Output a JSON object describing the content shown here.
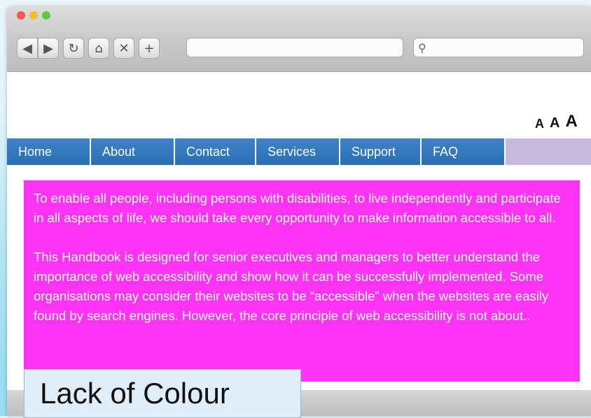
{
  "browser": {
    "controls": {
      "back_icon": "◀",
      "forward_icon": "▶",
      "reload_icon": "↻",
      "home_icon": "⌂",
      "stop_icon": "✕",
      "new_tab_icon": "+",
      "search_icon": "⚲"
    },
    "address": "",
    "search": ""
  },
  "page": {
    "text_size_controls": [
      "A",
      "A",
      "A"
    ],
    "nav": [
      "Home",
      "About",
      "Contact",
      "Services",
      "Support",
      "FAQ"
    ],
    "paragraphs": [
      "To enable all people, including persons with disabilities, to live independently and participate in all aspects of life, we should take every opportunity to make information accessible to all.",
      "This Handbook is designed for senior executives and managers to better understand the importance of web accessibility and show how it can be successfully implemented. Some organisations may consider their websites to be “accessible” when the websites are easily found by search engines. However, the core principle of web accessibility is not about.."
    ],
    "content_bg": "#ff33f5",
    "nav_color": "#2a6fb5"
  },
  "caption": "Lack of Colour"
}
